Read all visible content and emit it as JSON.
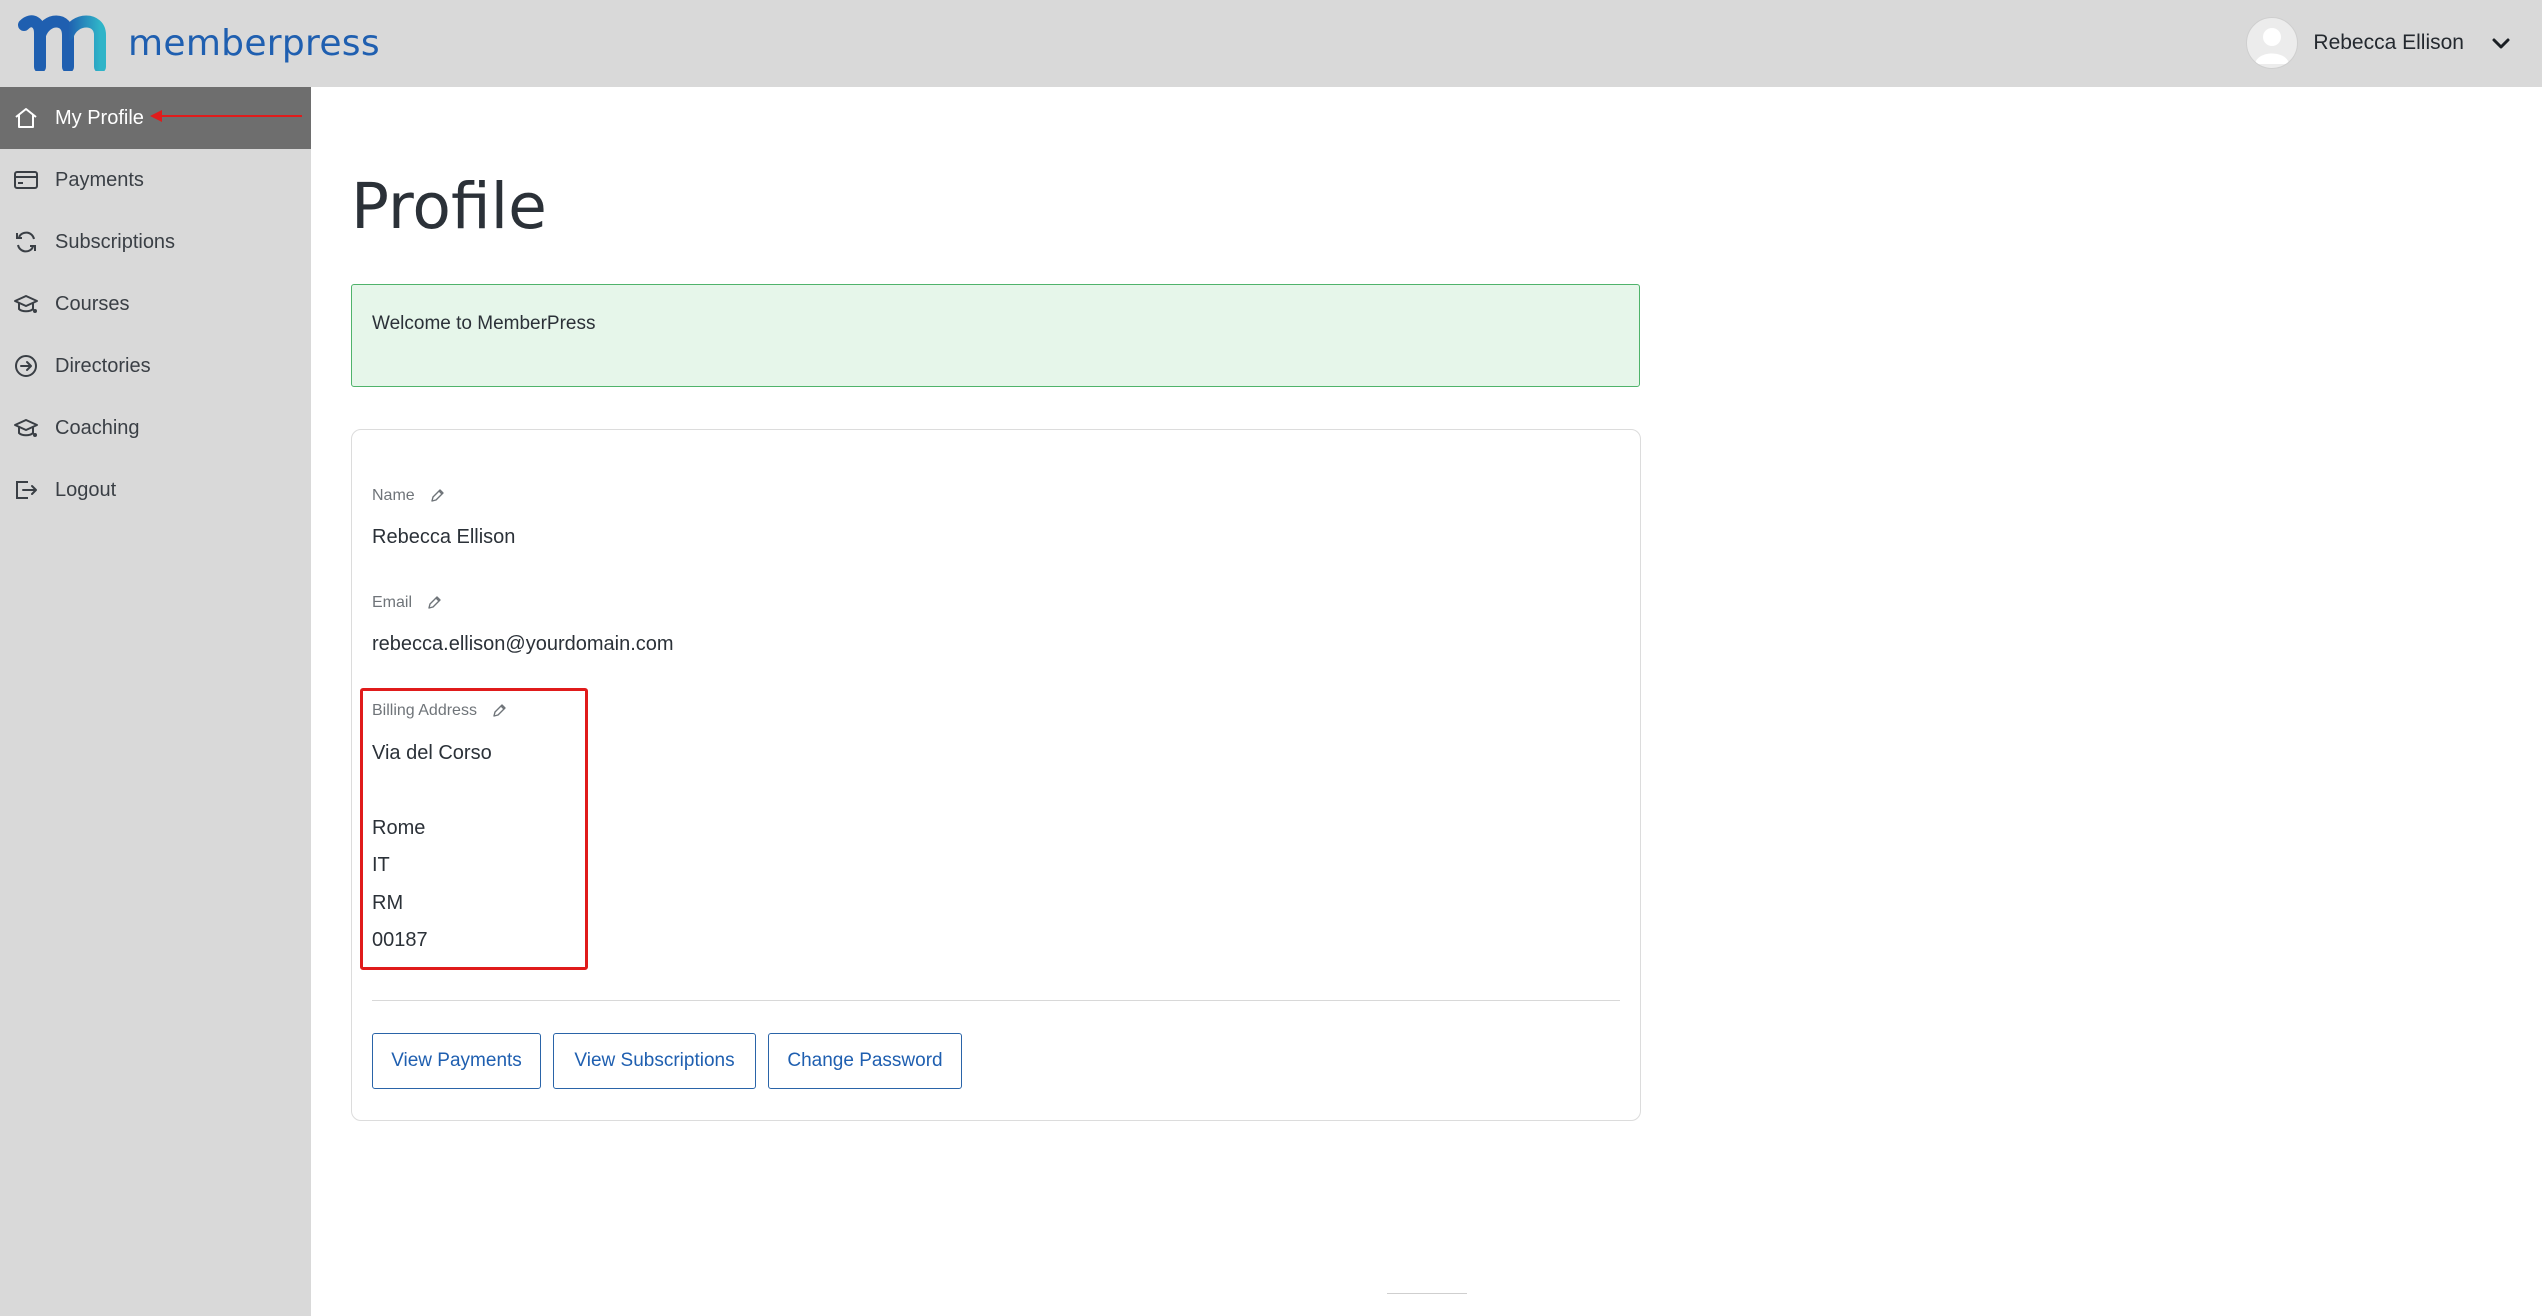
{
  "header": {
    "brand": "memberpress",
    "user_name": "Rebecca Ellison"
  },
  "sidebar": {
    "items": [
      {
        "label": "My Profile",
        "icon": "home-icon",
        "active": true
      },
      {
        "label": "Payments",
        "icon": "credit-card-icon"
      },
      {
        "label": "Subscriptions",
        "icon": "refresh-icon"
      },
      {
        "label": "Courses",
        "icon": "graduation-cap-icon"
      },
      {
        "label": "Directories",
        "icon": "arrow-circle-right-icon"
      },
      {
        "label": "Coaching",
        "icon": "graduation-cap-icon"
      },
      {
        "label": "Logout",
        "icon": "logout-icon"
      }
    ]
  },
  "main": {
    "title": "Profile",
    "welcome_message": "Welcome to MemberPress",
    "fields": {
      "name_label": "Name",
      "name_value": "Rebecca Ellison",
      "email_label": "Email",
      "email_value": "rebecca.ellison@yourdomain.com",
      "billing_label": "Billing Address",
      "billing_lines": [
        "Via del Corso",
        "",
        "Rome",
        "IT",
        "RM",
        "00187"
      ]
    },
    "buttons": {
      "view_payments": "View Payments",
      "view_subscriptions": "View Subscriptions",
      "change_password": "Change Password"
    }
  },
  "colors": {
    "accent": "#1f5fb0",
    "sidebar_bg": "#d9d9d9",
    "active_item_bg": "#6e6e6e",
    "success_bg": "#e6f6ea",
    "success_border": "#4fb36b",
    "annotation": "#e01b1b"
  }
}
